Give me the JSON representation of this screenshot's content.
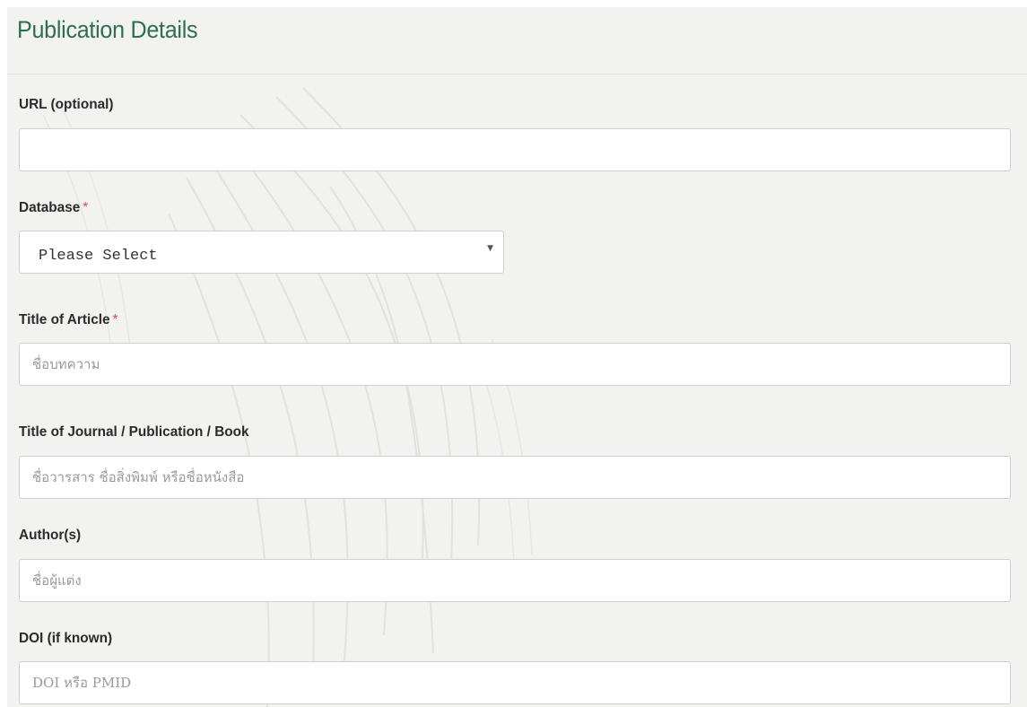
{
  "section": {
    "title": "Publication Details"
  },
  "fields": {
    "url": {
      "label": "URL (optional)",
      "value": "",
      "placeholder": ""
    },
    "database": {
      "label": "Database",
      "required_mark": "*",
      "selected": "Please Select",
      "caret_icon": "chevron-down-icon"
    },
    "article_title": {
      "label": "Title of Article",
      "required_mark": "*",
      "placeholder": "ชื่อบทความ"
    },
    "journal_title": {
      "label": "Title of Journal / Publication / Book",
      "placeholder": "ชื่อวารสาร ชื่อสิ่งพิมพ์ หรือชื่อหนังสือ"
    },
    "authors": {
      "label": "Author(s)",
      "placeholder": "ชื่อผู้แต่ง"
    },
    "doi": {
      "label": "DOI (if known)",
      "placeholder": "DOI หรือ PMID"
    }
  },
  "colors": {
    "title": "#2e6e52",
    "required": "#d9534f",
    "panel_background": "#f2f2f1"
  }
}
